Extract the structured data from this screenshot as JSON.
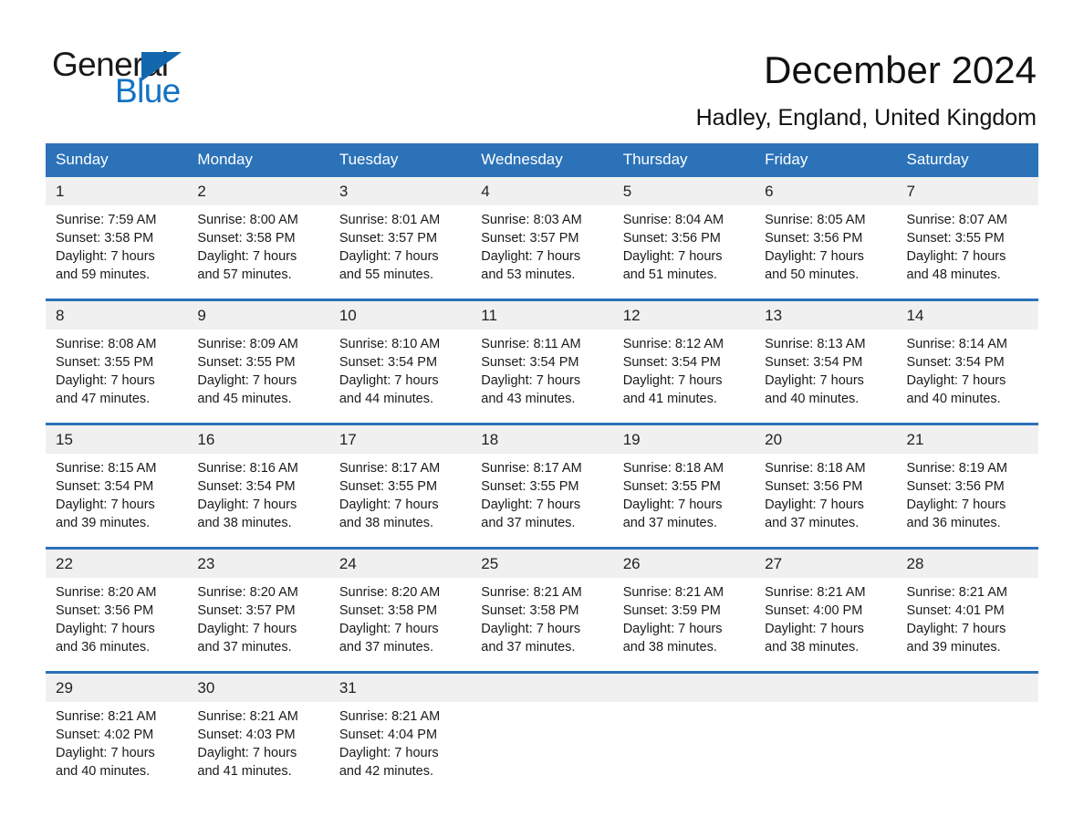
{
  "brand": {
    "name_part1": "General",
    "name_part2": "Blue",
    "triangle_color": "#1368ad",
    "blue_text_color": "#1273c4"
  },
  "header": {
    "title": "December 2024",
    "location": "Hadley, England, United Kingdom"
  },
  "theme": {
    "header_blue": "#2b72b8",
    "date_band_gray": "#f0f0f0",
    "page_background": "#ffffff"
  },
  "calendar": {
    "weekday_headers": [
      "Sunday",
      "Monday",
      "Tuesday",
      "Wednesday",
      "Thursday",
      "Friday",
      "Saturday"
    ],
    "weeks": [
      {
        "dates": [
          "1",
          "2",
          "3",
          "4",
          "5",
          "6",
          "7"
        ],
        "cells": [
          {
            "sunrise": "Sunrise: 7:59 AM",
            "sunset": "Sunset: 3:58 PM",
            "daylight1": "Daylight: 7 hours",
            "daylight2": "and 59 minutes."
          },
          {
            "sunrise": "Sunrise: 8:00 AM",
            "sunset": "Sunset: 3:58 PM",
            "daylight1": "Daylight: 7 hours",
            "daylight2": "and 57 minutes."
          },
          {
            "sunrise": "Sunrise: 8:01 AM",
            "sunset": "Sunset: 3:57 PM",
            "daylight1": "Daylight: 7 hours",
            "daylight2": "and 55 minutes."
          },
          {
            "sunrise": "Sunrise: 8:03 AM",
            "sunset": "Sunset: 3:57 PM",
            "daylight1": "Daylight: 7 hours",
            "daylight2": "and 53 minutes."
          },
          {
            "sunrise": "Sunrise: 8:04 AM",
            "sunset": "Sunset: 3:56 PM",
            "daylight1": "Daylight: 7 hours",
            "daylight2": "and 51 minutes."
          },
          {
            "sunrise": "Sunrise: 8:05 AM",
            "sunset": "Sunset: 3:56 PM",
            "daylight1": "Daylight: 7 hours",
            "daylight2": "and 50 minutes."
          },
          {
            "sunrise": "Sunrise: 8:07 AM",
            "sunset": "Sunset: 3:55 PM",
            "daylight1": "Daylight: 7 hours",
            "daylight2": "and 48 minutes."
          }
        ]
      },
      {
        "dates": [
          "8",
          "9",
          "10",
          "11",
          "12",
          "13",
          "14"
        ],
        "cells": [
          {
            "sunrise": "Sunrise: 8:08 AM",
            "sunset": "Sunset: 3:55 PM",
            "daylight1": "Daylight: 7 hours",
            "daylight2": "and 47 minutes."
          },
          {
            "sunrise": "Sunrise: 8:09 AM",
            "sunset": "Sunset: 3:55 PM",
            "daylight1": "Daylight: 7 hours",
            "daylight2": "and 45 minutes."
          },
          {
            "sunrise": "Sunrise: 8:10 AM",
            "sunset": "Sunset: 3:54 PM",
            "daylight1": "Daylight: 7 hours",
            "daylight2": "and 44 minutes."
          },
          {
            "sunrise": "Sunrise: 8:11 AM",
            "sunset": "Sunset: 3:54 PM",
            "daylight1": "Daylight: 7 hours",
            "daylight2": "and 43 minutes."
          },
          {
            "sunrise": "Sunrise: 8:12 AM",
            "sunset": "Sunset: 3:54 PM",
            "daylight1": "Daylight: 7 hours",
            "daylight2": "and 41 minutes."
          },
          {
            "sunrise": "Sunrise: 8:13 AM",
            "sunset": "Sunset: 3:54 PM",
            "daylight1": "Daylight: 7 hours",
            "daylight2": "and 40 minutes."
          },
          {
            "sunrise": "Sunrise: 8:14 AM",
            "sunset": "Sunset: 3:54 PM",
            "daylight1": "Daylight: 7 hours",
            "daylight2": "and 40 minutes."
          }
        ]
      },
      {
        "dates": [
          "15",
          "16",
          "17",
          "18",
          "19",
          "20",
          "21"
        ],
        "cells": [
          {
            "sunrise": "Sunrise: 8:15 AM",
            "sunset": "Sunset: 3:54 PM",
            "daylight1": "Daylight: 7 hours",
            "daylight2": "and 39 minutes."
          },
          {
            "sunrise": "Sunrise: 8:16 AM",
            "sunset": "Sunset: 3:54 PM",
            "daylight1": "Daylight: 7 hours",
            "daylight2": "and 38 minutes."
          },
          {
            "sunrise": "Sunrise: 8:17 AM",
            "sunset": "Sunset: 3:55 PM",
            "daylight1": "Daylight: 7 hours",
            "daylight2": "and 38 minutes."
          },
          {
            "sunrise": "Sunrise: 8:17 AM",
            "sunset": "Sunset: 3:55 PM",
            "daylight1": "Daylight: 7 hours",
            "daylight2": "and 37 minutes."
          },
          {
            "sunrise": "Sunrise: 8:18 AM",
            "sunset": "Sunset: 3:55 PM",
            "daylight1": "Daylight: 7 hours",
            "daylight2": "and 37 minutes."
          },
          {
            "sunrise": "Sunrise: 8:18 AM",
            "sunset": "Sunset: 3:56 PM",
            "daylight1": "Daylight: 7 hours",
            "daylight2": "and 37 minutes."
          },
          {
            "sunrise": "Sunrise: 8:19 AM",
            "sunset": "Sunset: 3:56 PM",
            "daylight1": "Daylight: 7 hours",
            "daylight2": "and 36 minutes."
          }
        ]
      },
      {
        "dates": [
          "22",
          "23",
          "24",
          "25",
          "26",
          "27",
          "28"
        ],
        "cells": [
          {
            "sunrise": "Sunrise: 8:20 AM",
            "sunset": "Sunset: 3:56 PM",
            "daylight1": "Daylight: 7 hours",
            "daylight2": "and 36 minutes."
          },
          {
            "sunrise": "Sunrise: 8:20 AM",
            "sunset": "Sunset: 3:57 PM",
            "daylight1": "Daylight: 7 hours",
            "daylight2": "and 37 minutes."
          },
          {
            "sunrise": "Sunrise: 8:20 AM",
            "sunset": "Sunset: 3:58 PM",
            "daylight1": "Daylight: 7 hours",
            "daylight2": "and 37 minutes."
          },
          {
            "sunrise": "Sunrise: 8:21 AM",
            "sunset": "Sunset: 3:58 PM",
            "daylight1": "Daylight: 7 hours",
            "daylight2": "and 37 minutes."
          },
          {
            "sunrise": "Sunrise: 8:21 AM",
            "sunset": "Sunset: 3:59 PM",
            "daylight1": "Daylight: 7 hours",
            "daylight2": "and 38 minutes."
          },
          {
            "sunrise": "Sunrise: 8:21 AM",
            "sunset": "Sunset: 4:00 PM",
            "daylight1": "Daylight: 7 hours",
            "daylight2": "and 38 minutes."
          },
          {
            "sunrise": "Sunrise: 8:21 AM",
            "sunset": "Sunset: 4:01 PM",
            "daylight1": "Daylight: 7 hours",
            "daylight2": "and 39 minutes."
          }
        ]
      },
      {
        "dates": [
          "29",
          "30",
          "31",
          "",
          "",
          "",
          ""
        ],
        "cells": [
          {
            "sunrise": "Sunrise: 8:21 AM",
            "sunset": "Sunset: 4:02 PM",
            "daylight1": "Daylight: 7 hours",
            "daylight2": "and 40 minutes."
          },
          {
            "sunrise": "Sunrise: 8:21 AM",
            "sunset": "Sunset: 4:03 PM",
            "daylight1": "Daylight: 7 hours",
            "daylight2": "and 41 minutes."
          },
          {
            "sunrise": "Sunrise: 8:21 AM",
            "sunset": "Sunset: 4:04 PM",
            "daylight1": "Daylight: 7 hours",
            "daylight2": "and 42 minutes."
          },
          {
            "sunrise": "",
            "sunset": "",
            "daylight1": "",
            "daylight2": ""
          },
          {
            "sunrise": "",
            "sunset": "",
            "daylight1": "",
            "daylight2": ""
          },
          {
            "sunrise": "",
            "sunset": "",
            "daylight1": "",
            "daylight2": ""
          },
          {
            "sunrise": "",
            "sunset": "",
            "daylight1": "",
            "daylight2": ""
          }
        ]
      }
    ]
  }
}
